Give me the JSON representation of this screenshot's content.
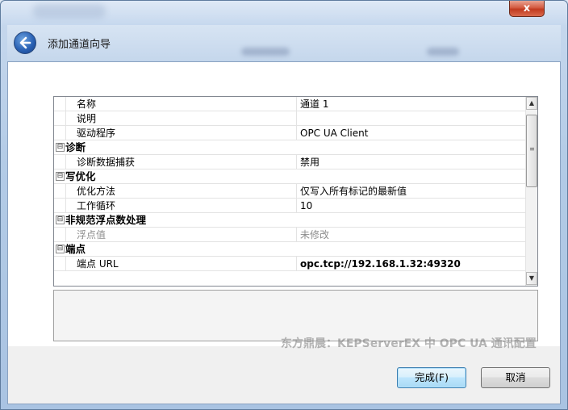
{
  "window": {
    "close_glyph": "x",
    "wizard_title": "添加通道向导",
    "back_icon": "back-arrow-icon"
  },
  "properties": [
    {
      "type": "item",
      "name": "名称",
      "value": "通道 1"
    },
    {
      "type": "item",
      "name": "说明",
      "value": ""
    },
    {
      "type": "item",
      "name": "驱动程序",
      "value": "OPC UA Client"
    },
    {
      "type": "category",
      "name": "诊断",
      "toggle": "⊟"
    },
    {
      "type": "item",
      "name": "诊断数据捕获",
      "value": "禁用"
    },
    {
      "type": "category",
      "name": "写优化",
      "toggle": "⊟"
    },
    {
      "type": "item",
      "name": "优化方法",
      "value": "仅写入所有标记的最新值"
    },
    {
      "type": "item",
      "name": "工作循环",
      "value": "10"
    },
    {
      "type": "category",
      "name": "非规范浮点数处理",
      "toggle": "⊟"
    },
    {
      "type": "item",
      "name": "浮点值",
      "value": "未修改",
      "disabled": true
    },
    {
      "type": "category",
      "name": "端点",
      "toggle": "⊟"
    },
    {
      "type": "item",
      "name": "端点 URL",
      "value": "opc.tcp://192.168.1.32:49320",
      "bold": true
    }
  ],
  "scrollbar": {
    "up": "▲",
    "down": "▼",
    "grip": "≡"
  },
  "watermark": "东方鼎晨：KEPServerEX 中 OPC UA 通讯配置",
  "buttons": {
    "finish": "完成(F)",
    "cancel": "取消"
  }
}
